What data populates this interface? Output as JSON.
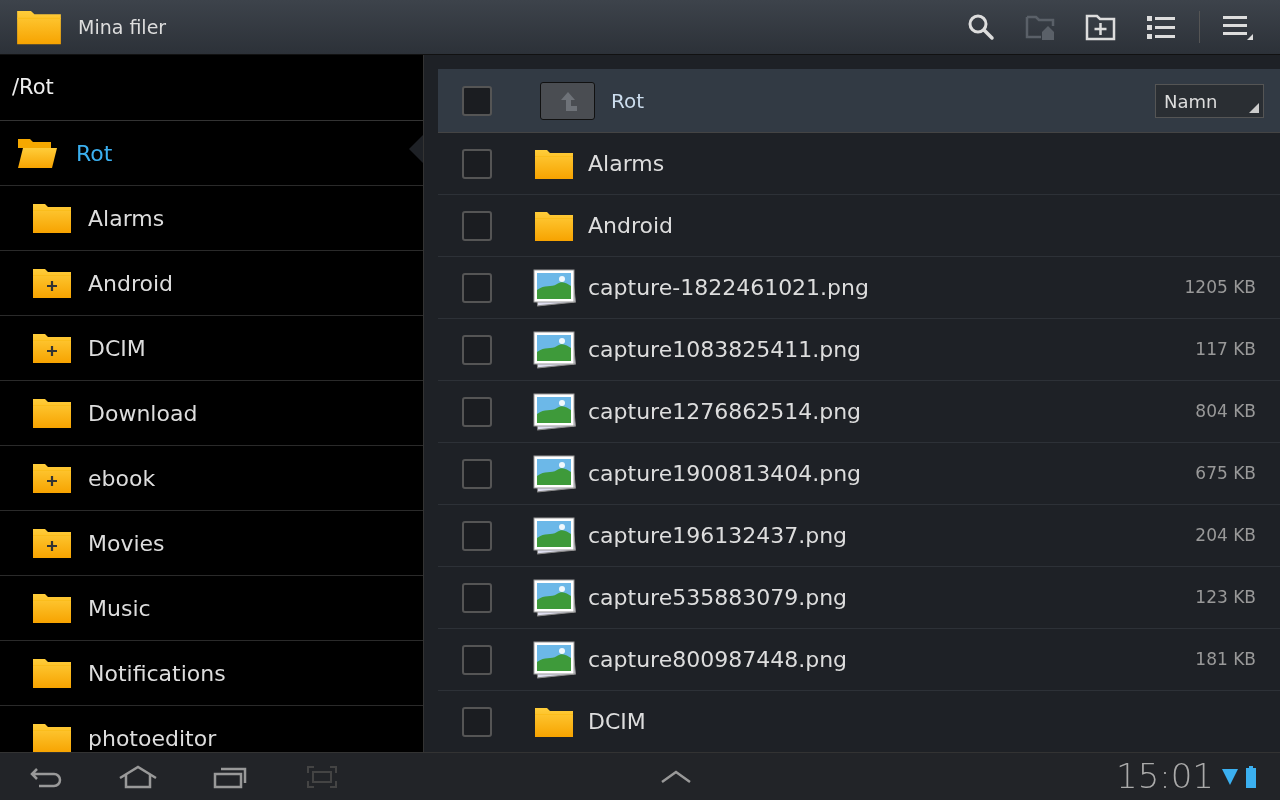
{
  "app_bar": {
    "title": "Mina filer"
  },
  "path": "/Rot",
  "tree": {
    "label": "Rot",
    "selected": true,
    "children": [
      {
        "label": "Alarms",
        "expandable": false
      },
      {
        "label": "Android",
        "expandable": true
      },
      {
        "label": "DCIM",
        "expandable": true
      },
      {
        "label": "Download",
        "expandable": false
      },
      {
        "label": "ebook",
        "expandable": true
      },
      {
        "label": "Movies",
        "expandable": true
      },
      {
        "label": "Music",
        "expandable": false
      },
      {
        "label": "Notifications",
        "expandable": false
      },
      {
        "label": "photoeditor",
        "expandable": false
      }
    ]
  },
  "list_header": {
    "checked": false,
    "folder": "Rot",
    "sort": "Namn"
  },
  "files": [
    {
      "kind": "folder",
      "name": "Alarms",
      "checked": false
    },
    {
      "kind": "folder",
      "name": "Android",
      "checked": false
    },
    {
      "kind": "image",
      "name": "capture-1822461021.png",
      "size": "1205 KB",
      "checked": false
    },
    {
      "kind": "image",
      "name": "capture1083825411.png",
      "size": "117 KB",
      "checked": false
    },
    {
      "kind": "image",
      "name": "capture1276862514.png",
      "size": "804 KB",
      "checked": false
    },
    {
      "kind": "image",
      "name": "capture1900813404.png",
      "size": "675 KB",
      "checked": false
    },
    {
      "kind": "image",
      "name": "capture196132437.png",
      "size": "204 KB",
      "checked": false
    },
    {
      "kind": "image",
      "name": "capture535883079.png",
      "size": "123 KB",
      "checked": false
    },
    {
      "kind": "image",
      "name": "capture800987448.png",
      "size": "181 KB",
      "checked": false
    },
    {
      "kind": "folder",
      "name": "DCIM",
      "checked": false
    }
  ],
  "status_bar": {
    "time": "15:01"
  }
}
